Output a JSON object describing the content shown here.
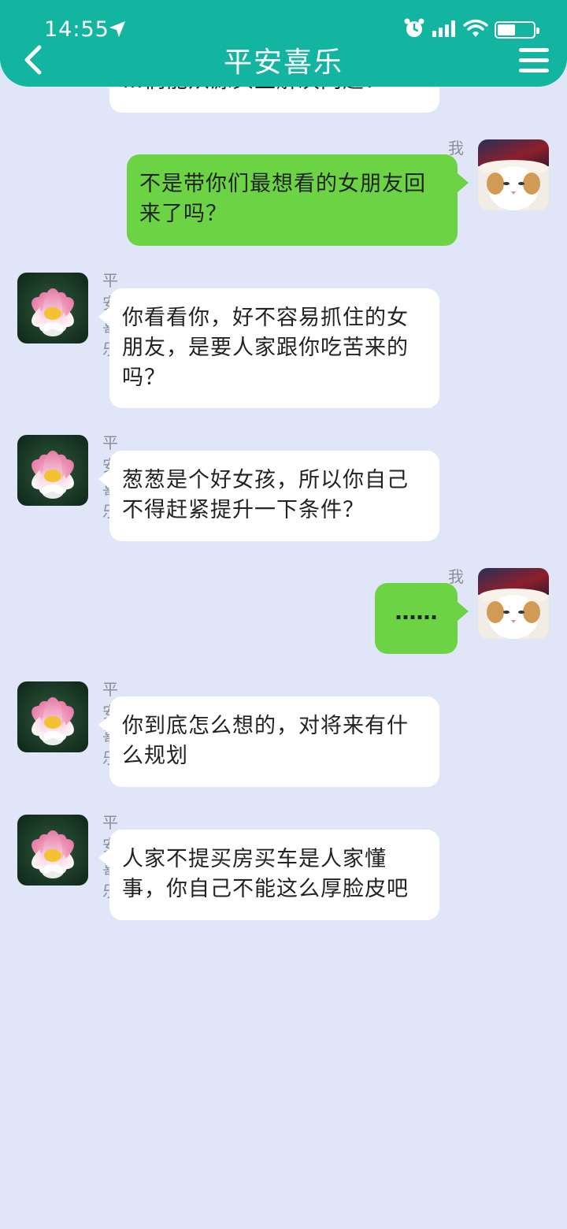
{
  "status_bar": {
    "time": "14:55"
  },
  "header": {
    "title": "平安喜乐"
  },
  "messages": [
    {
      "sender": "平安喜乐",
      "text": "…们能从源头上解决问题？"
    },
    {
      "sender": "我",
      "text": "不是带你们最想看的女朋友回来了吗？"
    },
    {
      "sender": "平安喜乐",
      "text": "你看看你，好不容易抓住的女朋友，是要人家跟你吃苦来的吗？"
    },
    {
      "sender": "平安喜乐",
      "text": "葱葱是个好女孩，所以你自己不得赶紧提升一下条件？"
    },
    {
      "sender": "我",
      "text": "……"
    },
    {
      "sender": "平安喜乐",
      "text": "你到底怎么想的，对将来有什么规划"
    },
    {
      "sender": "平安喜乐",
      "text": "人家不提买房买车是人家懂事，你自己不能这么厚脸皮吧"
    }
  ],
  "colors": {
    "header": "#13b5a0",
    "background": "#e0e6f8",
    "outgoing_bubble": "#6cd444",
    "incoming_bubble": "#ffffff"
  },
  "icons": {
    "back": "chevron-left-icon",
    "menu": "hamburger-menu-icon",
    "location": "location-arrow-icon",
    "alarm": "alarm-icon",
    "signal": "signal-icon",
    "wifi": "wifi-icon",
    "battery": "battery-icon"
  },
  "battery_level": 0.45
}
